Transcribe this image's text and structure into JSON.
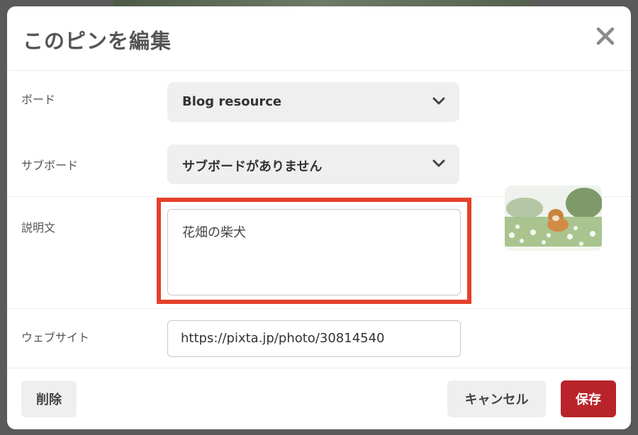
{
  "modal": {
    "title": "このピンを編集"
  },
  "board": {
    "label": "ボード",
    "value": "Blog resource"
  },
  "subboard": {
    "label": "サブボード",
    "value": "サブボードがありません"
  },
  "description": {
    "label": "説明文",
    "value": "花畑の柴犬"
  },
  "website": {
    "label": "ウェブサイト",
    "value": "https://pixta.jp/photo/30814540"
  },
  "footer": {
    "delete_label": "削除",
    "cancel_label": "キャンセル",
    "save_label": "保存"
  },
  "colors": {
    "highlight": "#e4402b",
    "save_button": "#b8242a"
  },
  "icons": {
    "close": "close-icon",
    "dropdown": "chevron-down-icon"
  }
}
